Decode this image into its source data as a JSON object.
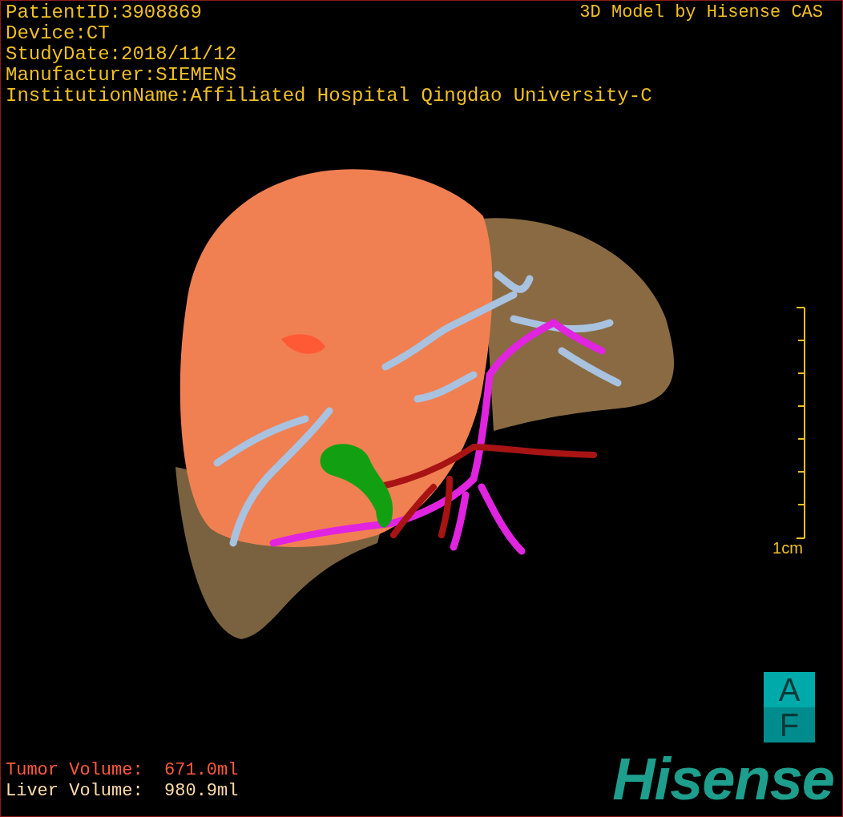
{
  "header": {
    "info_lines": [
      "PatientID:3908869",
      "Device:CT",
      "StudyDate:2018/11/12",
      "Manufacturer:SIEMENS",
      "InstitutionName:Affiliated Hospital Qingdao University-C"
    ],
    "credit": "3D Model by Hisense CAS"
  },
  "viewport": {
    "scale_label": "1cm"
  },
  "volumes": [
    {
      "text": "Tumor Volume:  671.0ml",
      "color": "#ff5a3c"
    },
    {
      "text": "Liver Volume:  980.9ml",
      "color": "#ffdcaa"
    }
  ],
  "orientation_cube": {
    "top": "A",
    "bottom": "F"
  },
  "logo": "Hisense"
}
